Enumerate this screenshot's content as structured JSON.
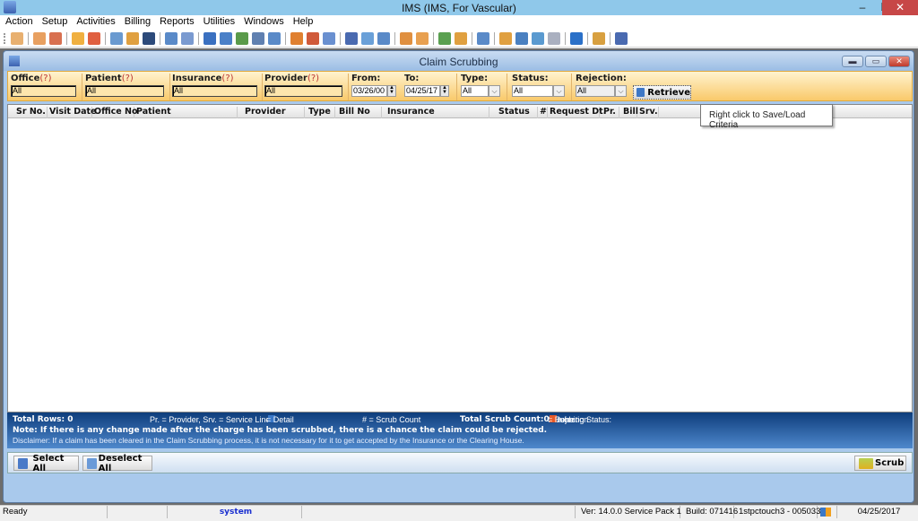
{
  "window": {
    "title": "IMS (IMS, For Vascular)",
    "minimize": "–",
    "restore": "❐",
    "close": "✕"
  },
  "menu": [
    "Action",
    "Setup",
    "Activities",
    "Billing",
    "Reports",
    "Utilities",
    "Windows",
    "Help"
  ],
  "toolbar": {
    "groups": [
      [
        {
          "icon": "patient-icon",
          "color": "#e8b070"
        }
      ],
      [
        {
          "icon": "patient-edit-icon",
          "color": "#e8a060"
        },
        {
          "icon": "patient-check-icon",
          "color": "#d87050"
        }
      ],
      [
        {
          "icon": "folder-icon",
          "color": "#f0b040"
        },
        {
          "icon": "provider-edit-icon",
          "color": "#e06040"
        }
      ],
      [
        {
          "icon": "prescription-icon",
          "color": "#6a9ad0"
        },
        {
          "icon": "lab-flask-icon",
          "color": "#e0a040"
        },
        {
          "icon": "shield-icon",
          "color": "#2c4a7a"
        }
      ],
      [
        {
          "icon": "document-icon",
          "color": "#5a8ac8"
        },
        {
          "icon": "notes-icon",
          "color": "#7a9ad0"
        }
      ],
      [
        {
          "icon": "billing-icon",
          "color": "#3a70c0"
        },
        {
          "icon": "payment-icon",
          "color": "#4a80c8"
        },
        {
          "icon": "claims-icon",
          "color": "#5a9a4a"
        },
        {
          "icon": "transfer-icon",
          "color": "#6080b0"
        },
        {
          "icon": "ledger-icon",
          "color": "#5a8ac8"
        }
      ],
      [
        {
          "icon": "calendar-icon",
          "color": "#e08030"
        },
        {
          "icon": "scheduler-icon",
          "color": "#d05a3a"
        },
        {
          "icon": "report-icon",
          "color": "#6a90d0"
        }
      ],
      [
        {
          "icon": "send-icon",
          "color": "#4a6ab0"
        },
        {
          "icon": "inbox-icon",
          "color": "#6aa0d8"
        },
        {
          "icon": "outbox-icon",
          "color": "#5a8ac8"
        }
      ],
      [
        {
          "icon": "calendar-edit-icon",
          "color": "#e09040"
        },
        {
          "icon": "appointment-icon",
          "color": "#e8a050"
        }
      ],
      [
        {
          "icon": "chart-icon",
          "color": "#5aa050"
        },
        {
          "icon": "folder-user-icon",
          "color": "#e0a040"
        }
      ],
      [
        {
          "icon": "clipboard-icon",
          "color": "#5a8ac8"
        }
      ],
      [
        {
          "icon": "fax-icon",
          "color": "#e0a040"
        },
        {
          "icon": "exchange-icon",
          "color": "#4a80c0"
        },
        {
          "icon": "task-icon",
          "color": "#5a9ad0"
        },
        {
          "icon": "calculator-icon",
          "color": "#aab0c0"
        }
      ],
      [
        {
          "icon": "help-icon",
          "color": "#2a70c8"
        }
      ],
      [
        {
          "icon": "lock-icon",
          "color": "#d8a040"
        }
      ],
      [
        {
          "icon": "exit-icon",
          "color": "#4a6ab0"
        }
      ]
    ]
  },
  "child_window": {
    "title": "Claim Scrubbing",
    "min": "▬",
    "max": "▭",
    "close": "✕"
  },
  "filters": {
    "office": {
      "label": "Office",
      "hint": "(?)",
      "value": "All"
    },
    "patient": {
      "label": "Patient",
      "hint": "(?)",
      "value": "All"
    },
    "insurance": {
      "label": "Insurance",
      "hint": "(?)",
      "value": "All"
    },
    "provider": {
      "label": "Provider",
      "hint": "(?)",
      "value": "All"
    },
    "from": {
      "label": "From:",
      "value": "03/26/00"
    },
    "to": {
      "label": "To:",
      "value": "04/25/17"
    },
    "type": {
      "label": "Type:",
      "value": "All"
    },
    "status": {
      "label": "Status:",
      "value": "All"
    },
    "rejection": {
      "label": "Rejection:",
      "value": "All"
    },
    "retrieve_label": "Retrieve"
  },
  "grid": {
    "columns": [
      "Sr No.",
      "Visit Date",
      "Office No",
      "Patient",
      "Provider",
      "Type",
      "Bill No",
      "Insurance",
      "Status",
      "#",
      "Request Dt.",
      "Pr.",
      "Bill",
      "Srv."
    ],
    "rows": []
  },
  "tooltip": "Right click to Save/Load Criteria",
  "info": {
    "total_rows": "Total Rows: 0",
    "legend_pr": "Pr. = Provider, Srv. = Service Line",
    "legend_detail": "= Detail",
    "legend_scrub_count": "# = Scrub Count",
    "total_scrub_count": "Total Scrub Count:0",
    "scrubbing_status_label": "Scrubbing Status:",
    "done_label": "= Done",
    "rejection_label": "= Rejection",
    "done_color": "#6fbf3a",
    "rejection_color": "#e85a28",
    "note": "Note: If there is any change made after the charge has been scrubbed, there is a chance the claim could be rejected.",
    "disclaimer": "Disclaimer: If a claim has been cleared in the Claim Scrubbing process, it is not necessary for it to get accepted by the Insurance or the Clearing House."
  },
  "buttons": {
    "select_all": "Select All",
    "deselect_all": "Deselect All",
    "scrub": "Scrub"
  },
  "statusbar": {
    "status": "Ready",
    "user": "system",
    "version": "Ver: 14.0.0 Service Pack 1",
    "build": "Build: 071416",
    "station": "1stpctouch3 - 0050335",
    "date": "04/25/2017"
  }
}
